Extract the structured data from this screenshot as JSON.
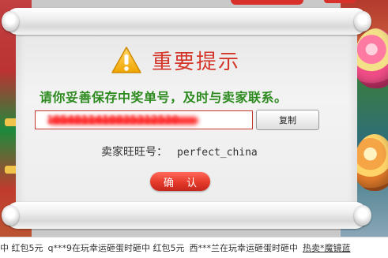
{
  "dialog": {
    "title": "重要提示",
    "message": "请你妥善保存中奖单号，及时与卖家联系。",
    "order_number": "1054811410835312530",
    "copy_button": "复制",
    "contact_label": "卖家旺旺号：",
    "contact_value": "perfect_china",
    "confirm_button": "确 认"
  },
  "ticker": {
    "segments": [
      "中  红包5元",
      "q***9在玩幸运砸蛋时砸中  红包5元",
      "西***兰在玩幸运砸蛋时砸中",
      "热卖*魔镜蓝"
    ]
  },
  "colors": {
    "title_red": "#d4362a",
    "message_green": "#2d8a1f",
    "button_red": "#e43a2b"
  },
  "icons": {
    "warning": "warning-triangle-icon"
  }
}
